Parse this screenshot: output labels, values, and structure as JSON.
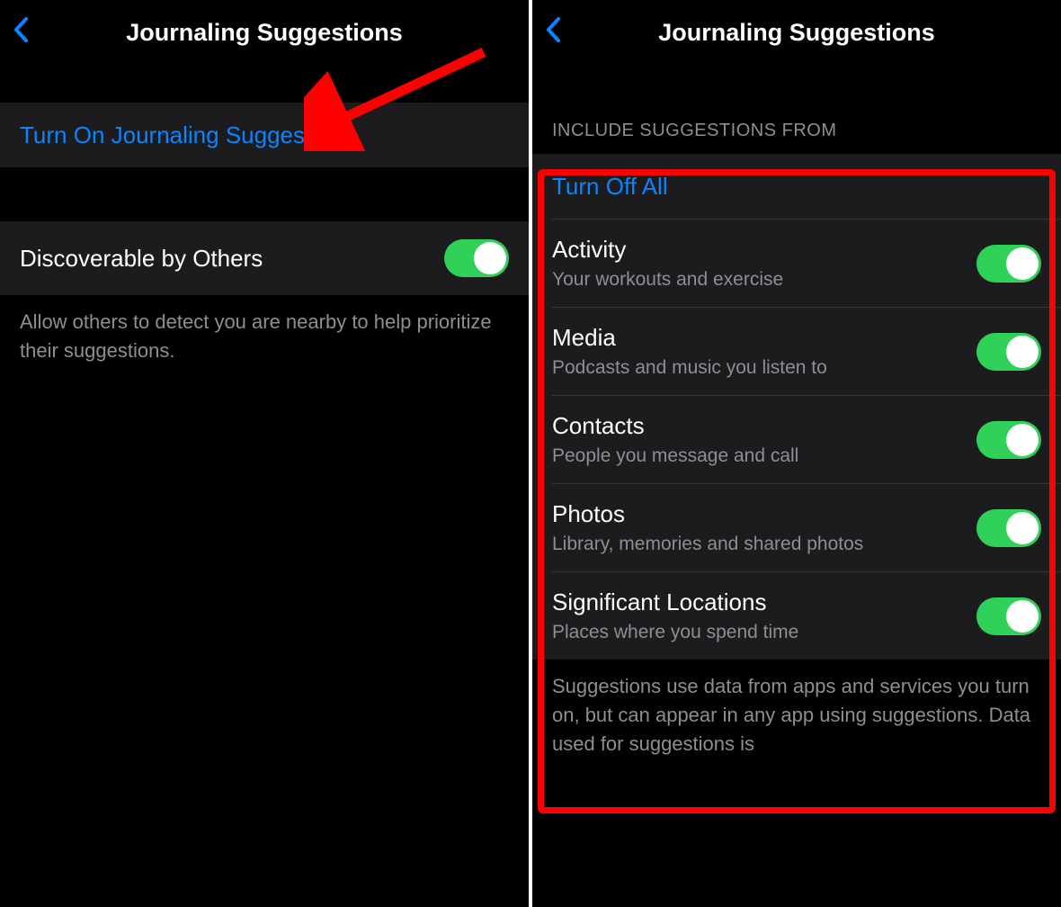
{
  "left": {
    "title": "Journaling Suggestions",
    "turn_on_label": "Turn On Journaling Suggestions",
    "discoverable": {
      "label": "Discoverable by Others",
      "enabled": true
    },
    "footer": "Allow others to detect you are nearby to help prioritize their suggestions."
  },
  "right": {
    "title": "Journaling Suggestions",
    "section_header": "INCLUDE SUGGESTIONS FROM",
    "turn_off_all": "Turn Off All",
    "items": [
      {
        "label": "Activity",
        "sublabel": "Your workouts and exercise",
        "enabled": true
      },
      {
        "label": "Media",
        "sublabel": "Podcasts and music you listen to",
        "enabled": true
      },
      {
        "label": "Contacts",
        "sublabel": "People you message and call",
        "enabled": true
      },
      {
        "label": "Photos",
        "sublabel": "Library, memories and shared photos",
        "enabled": true
      },
      {
        "label": "Significant Locations",
        "sublabel": "Places where you spend time",
        "enabled": true
      }
    ],
    "footer": "Suggestions use data from apps and services you turn on, but can appear in any app using suggestions. Data used for suggestions is"
  },
  "colors": {
    "link": "#0a84ff",
    "toggle_on": "#30d158",
    "annotation": "#ff0000"
  }
}
